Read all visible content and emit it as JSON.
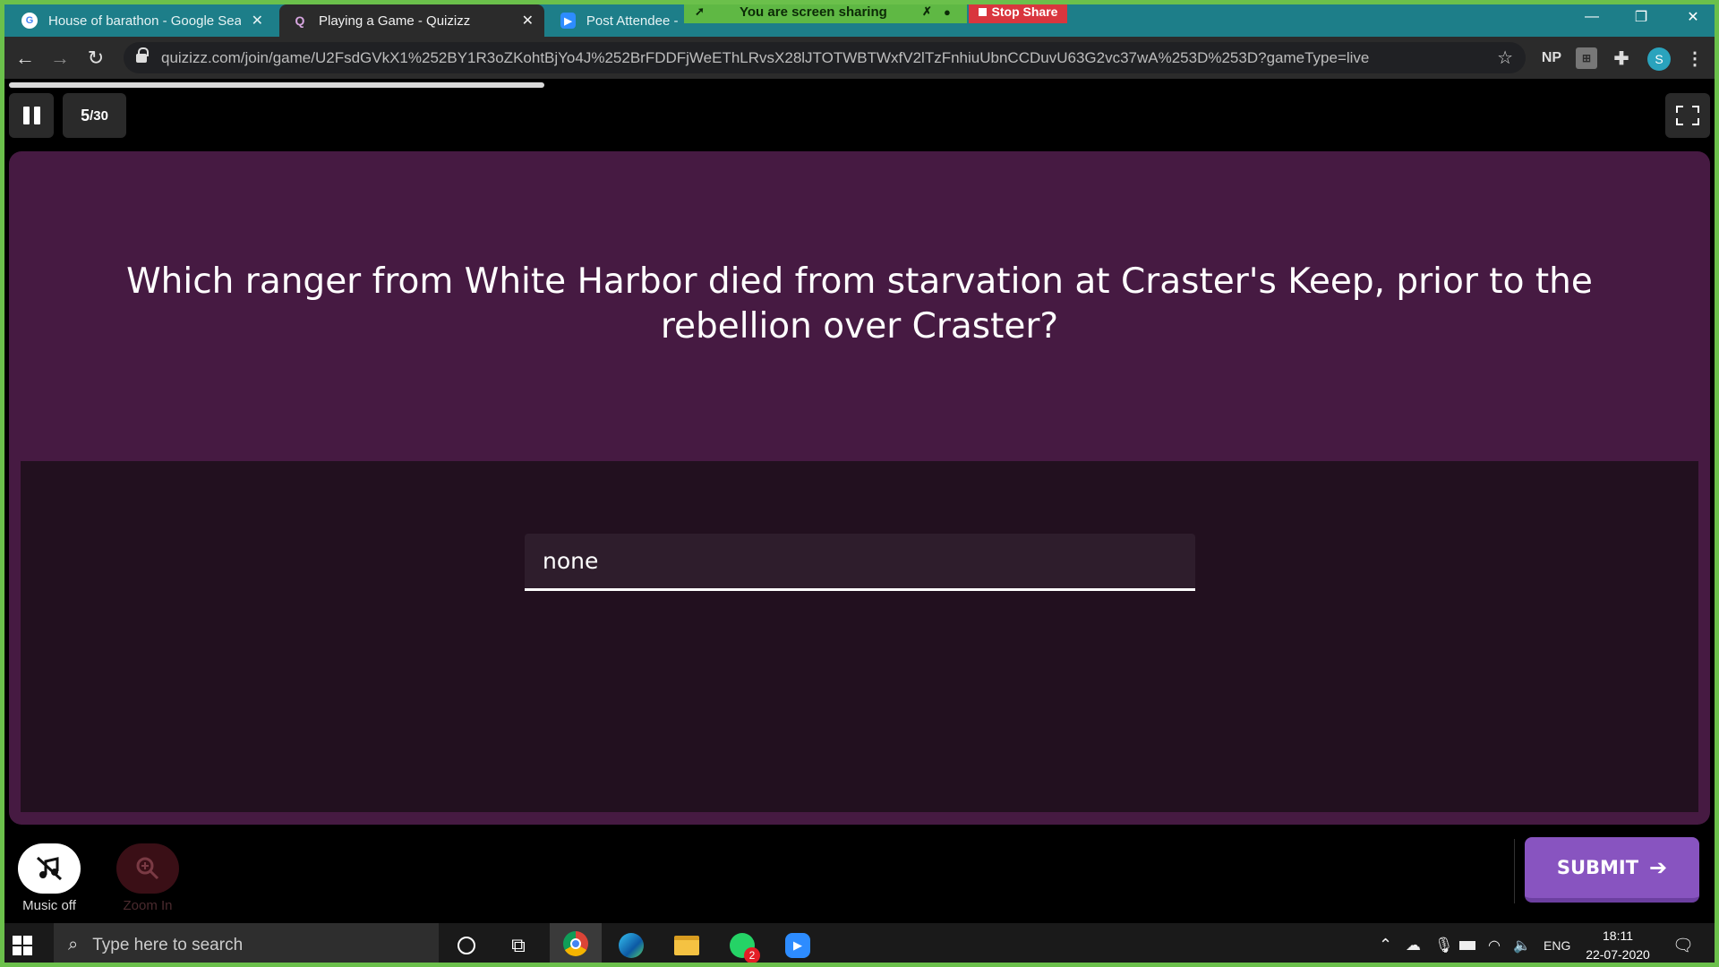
{
  "browser": {
    "tabs": [
      {
        "title": "House of barathon - Google Sea",
        "icon": "google-icon",
        "active": false
      },
      {
        "title": "Playing a Game - Quizizz",
        "icon": "quizizz-icon",
        "active": true
      },
      {
        "title": "Post Attendee - Z",
        "icon": "zoom-icon",
        "active": false
      }
    ],
    "url": "quizizz.com/join/game/U2FsdGVkX1%252BY1R3oZKohtBjYo4J%252BrFDDFjWeEThLRvsX28lJTOTWBTWxfV2lTzFnhiuUbnCCDuvU63G2vc37wA%253D%253D?gameType=live",
    "extension_np": "NP",
    "profile_initial": "S"
  },
  "screen_share": {
    "banner": "You are screen sharing",
    "stop_label": "Stop Share"
  },
  "quiz": {
    "counter_current": "5",
    "counter_total": "/30",
    "progress": 0.26,
    "question": "Which ranger from White Harbor died from starvation at Craster's Keep, prior to the rebellion over Craster?",
    "answer_value": "none",
    "music_label": "Music off",
    "zoom_label": "Zoom In",
    "submit_label": "SUBMIT"
  },
  "taskbar": {
    "search_placeholder": "Type here to search",
    "whatsapp_badge": "2",
    "language": "ENG",
    "time": "18:11",
    "date": "22-07-2020"
  },
  "colors": {
    "question_bg": "#461a42",
    "answer_bg": "#22101f",
    "submit_bg": "#8854c0",
    "share_green": "#5fb844",
    "stop_red": "#d9363e"
  }
}
